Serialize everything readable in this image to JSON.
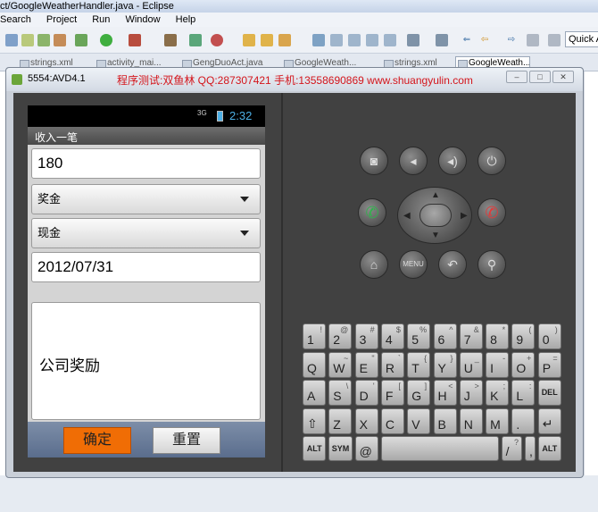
{
  "eclipse": {
    "title": "ct/GoogleWeatherHandler.java - Eclipse",
    "menu": [
      "Search",
      "Project",
      "Run",
      "Window",
      "Help"
    ],
    "quick_access": "Quick A",
    "tabs": [
      "strings.xml",
      "activity_mai...",
      "GengDuoAct.java",
      "GoogleWeath...",
      "strings.xml",
      "GoogleWeath..."
    ]
  },
  "emulator": {
    "title": "5554:AVD4.1",
    "watermark": "程序测试:双鱼林 QQ:287307421 手机:13558690869 www.shuangyulin.com",
    "status": {
      "signal": "3G",
      "time": "2:32",
      "battery_color": "#4db0e6"
    },
    "app": {
      "title": "收入一笔",
      "amount": "180",
      "category": "奖金",
      "account": "现金",
      "date": "2012/07/31",
      "note": "公司奖励",
      "confirm_label": "确定",
      "reset_label": "重置",
      "confirm_color": "#f06d05"
    },
    "hardware": {
      "menu_label": "MENU",
      "icons": [
        "camera-icon",
        "volume-down-icon",
        "volume-up-icon",
        "power-icon",
        "call-icon",
        "end-call-icon",
        "home-icon",
        "menu-icon",
        "back-icon",
        "search-icon"
      ]
    },
    "keyboard": {
      "rows": [
        [
          [
            "1",
            "!"
          ],
          [
            "2",
            "@"
          ],
          [
            "3",
            "#"
          ],
          [
            "4",
            "$"
          ],
          [
            "5",
            "%"
          ],
          [
            "6",
            "^"
          ],
          [
            "7",
            "&"
          ],
          [
            "8",
            "*"
          ],
          [
            "9",
            "("
          ],
          [
            "0",
            ")"
          ]
        ],
        [
          [
            "Q",
            ""
          ],
          [
            "W",
            "~"
          ],
          [
            "E",
            "\""
          ],
          [
            "R",
            "`"
          ],
          [
            "T",
            "{"
          ],
          [
            "Y",
            "}"
          ],
          [
            "U",
            "_"
          ],
          [
            "I",
            "-"
          ],
          [
            "O",
            "+"
          ],
          [
            "P",
            "="
          ]
        ],
        [
          [
            "A",
            ""
          ],
          [
            "S",
            "\\"
          ],
          [
            "D",
            "'"
          ],
          [
            "F",
            "["
          ],
          [
            "G",
            "]"
          ],
          [
            "H",
            "<"
          ],
          [
            "J",
            ">"
          ],
          [
            "K",
            ";"
          ],
          [
            "L",
            ":"
          ],
          [
            "DEL",
            ""
          ]
        ],
        [
          [
            "⇧",
            ""
          ],
          [
            "Z",
            ""
          ],
          [
            "X",
            ""
          ],
          [
            "C",
            ""
          ],
          [
            "V",
            ""
          ],
          [
            "B",
            ""
          ],
          [
            "N",
            ""
          ],
          [
            "M",
            ""
          ],
          [
            ".",
            ""
          ],
          [
            "↵",
            ""
          ]
        ],
        [
          [
            "ALT",
            ""
          ],
          [
            "SYM",
            ""
          ],
          [
            "@",
            ""
          ],
          [
            "",
            ""
          ],
          [
            "/",
            "?"
          ],
          [
            ",",
            ""
          ],
          [
            "ALT",
            ""
          ]
        ]
      ]
    }
  }
}
